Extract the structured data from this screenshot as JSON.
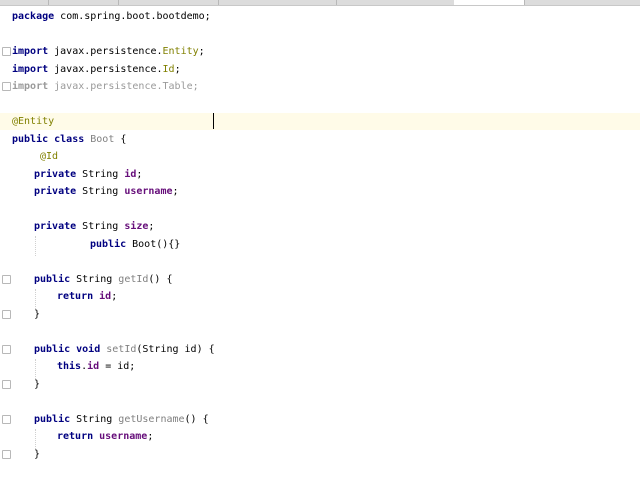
{
  "tabs": [
    {
      "label": "",
      "active": false
    },
    {
      "label": "",
      "active": false
    },
    {
      "label": "",
      "active": false
    },
    {
      "label": "",
      "active": false
    },
    {
      "label": "",
      "active": false
    },
    {
      "label": "",
      "active": true
    },
    {
      "label": "",
      "active": false
    }
  ],
  "code": {
    "l_package": {
      "kw": "package",
      "rest": " com.spring.boot.bootdemo;"
    },
    "l_import1": {
      "kw": "import",
      "pkg": " javax.persistence.",
      "cls": "Entity",
      "semi": ";"
    },
    "l_import2": {
      "kw": "import",
      "pkg": " javax.persistence.",
      "cls": "Id",
      "semi": ";"
    },
    "l_import3": {
      "kw": "import",
      "pkg": " javax.persistence.",
      "cls": "Table",
      "semi": ";"
    },
    "l_entity": {
      "ann": "@Entity"
    },
    "l_class": {
      "kw": "public class",
      "name": " Boot",
      "rest": " {"
    },
    "l_id_ann": {
      "ann": "@Id"
    },
    "l_field_id": {
      "kw": "private",
      "type": " String ",
      "name": "id",
      "semi": ";"
    },
    "l_field_username": {
      "kw": "private",
      "type": " String ",
      "name": "username",
      "semi": ";"
    },
    "l_field_size": {
      "kw": "private",
      "type": " String ",
      "name": "size",
      "semi": ";"
    },
    "l_ctor": {
      "kw": "public",
      "rest": " Boot(){}"
    },
    "l_getid": {
      "kw": "public",
      "type": " String ",
      "name": "getId",
      "rest": "() {"
    },
    "l_ret_id": {
      "kw": "return",
      "name": " id",
      "semi": ";"
    },
    "l_close1": {
      "text": "}"
    },
    "l_setid": {
      "kw": "public void",
      "name": " setId",
      "rest": "(String id) {"
    },
    "l_this_id": {
      "kw": "this",
      "dot": ".",
      "name": "id",
      "rest": " = id;"
    },
    "l_close2": {
      "text": "}"
    },
    "l_getusername": {
      "kw": "public",
      "type": " String ",
      "name": "getUsername",
      "rest": "() {"
    },
    "l_ret_username": {
      "kw": "return",
      "name": " username",
      "semi": ";"
    },
    "l_close3": {
      "text": "}"
    }
  }
}
